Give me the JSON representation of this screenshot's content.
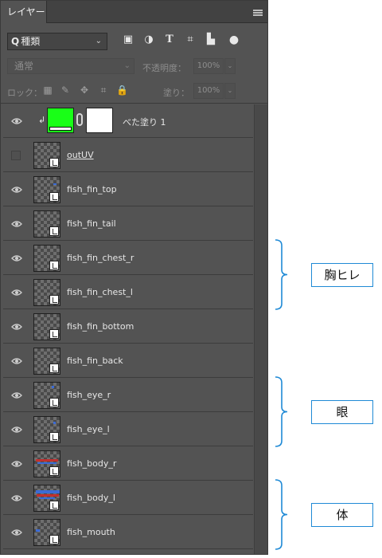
{
  "panel": {
    "tab_label": "レイヤー",
    "menu_icon": "panel-menu-icon"
  },
  "filter": {
    "search_icon": "search-icon",
    "kind_label": "種類",
    "filter_icons": [
      "image-filter-icon",
      "adjustment-filter-icon",
      "type-filter-icon",
      "shape-filter-icon",
      "smart-object-filter-icon",
      "filter-toggle-icon"
    ]
  },
  "blend": {
    "mode": "通常",
    "opacity_label": "不透明度：",
    "opacity_value": "100%"
  },
  "lock": {
    "label": "ロック：",
    "icons": [
      "lock-transparent-pixels-icon",
      "lock-image-pixels-icon",
      "lock-position-icon",
      "lock-artboard-icon",
      "lock-all-icon"
    ],
    "fill_label": "塗り：",
    "fill_value": "100%"
  },
  "layers": [
    {
      "name": "べた塗り 1",
      "type": "fill",
      "visible": true,
      "clipped": true,
      "fill_color": "#19ff17"
    },
    {
      "name": "outUV",
      "type": "smart",
      "visible": false,
      "underline": true
    },
    {
      "name": "fish_fin_top",
      "type": "smart",
      "visible": true
    },
    {
      "name": "fish_fin_tail",
      "type": "smart",
      "visible": true
    },
    {
      "name": "fish_fin_chest_r",
      "type": "smart",
      "visible": true
    },
    {
      "name": "fish_fin_chest_l",
      "type": "smart",
      "visible": true
    },
    {
      "name": "fish_fin_bottom",
      "type": "smart",
      "visible": true
    },
    {
      "name": "fish_fin_back",
      "type": "smart",
      "visible": true
    },
    {
      "name": "fish_eye_r",
      "type": "smart",
      "visible": true
    },
    {
      "name": "fish_eye_l",
      "type": "smart",
      "visible": true
    },
    {
      "name": "fish_body_r",
      "type": "smart",
      "visible": true
    },
    {
      "name": "fish_body_l",
      "type": "smart",
      "visible": true
    },
    {
      "name": "fish_mouth",
      "type": "smart",
      "visible": true
    }
  ],
  "annotations": [
    {
      "label": "胸ヒレ",
      "group": [
        "fish_fin_chest_r",
        "fish_fin_chest_l"
      ]
    },
    {
      "label": "眼",
      "group": [
        "fish_eye_r",
        "fish_eye_l"
      ]
    },
    {
      "label": "体",
      "group": [
        "fish_body_l",
        "fish_mouth"
      ]
    }
  ],
  "colors": {
    "panel_bg": "#535353",
    "accent_fill": "#19ff17",
    "annotation_border": "#1f8ad6"
  }
}
